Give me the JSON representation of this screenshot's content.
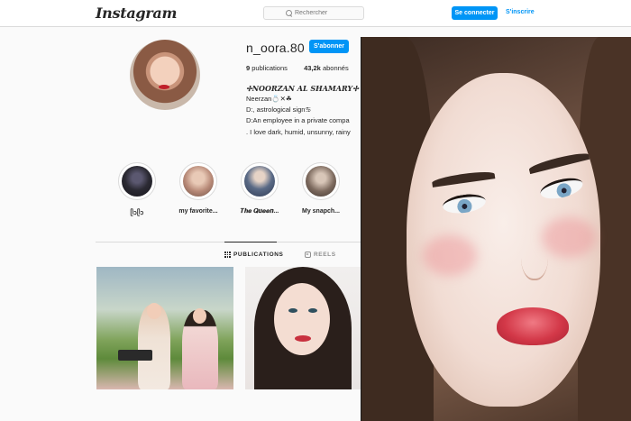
{
  "topbar": {
    "logo": "Instagram",
    "search_placeholder": "Rechercher",
    "login_label": "Se connecter",
    "signup_label": "S'inscrire"
  },
  "profile": {
    "username": "n_oora.80",
    "follow_label": "S'abonner",
    "stats": {
      "publications_count": "9",
      "publications_label": "publications",
      "followers_count": "43,2k",
      "followers_label": "abonnés"
    },
    "bio": {
      "name": "✢NOORZAN AL SHAMARY✢",
      "lines": [
        "Neerzan💍✕☘",
        "D:, astrological sign♋",
        "D:An employee in a private compa",
        ". I love dark, humid, unsunny, rainy"
      ]
    }
  },
  "highlights": [
    {
      "label": "ᥫᩣᥫᩣ",
      "color": "#2b2a33"
    },
    {
      "label": "my favorite...",
      "color": "#b88a78"
    },
    {
      "label": "𝑻𝒉𝒆 𝑸𝒖𝒆𝒆𝒏...",
      "color": "#5a6a86"
    },
    {
      "label": "My snapch...",
      "color": "#7d6a5e"
    }
  ],
  "tabs": {
    "publications": "PUBLICATIONS",
    "reels": "REELS"
  },
  "colors": {
    "accent": "#0095f6",
    "text": "#262626",
    "border": "#dbdbdb"
  }
}
